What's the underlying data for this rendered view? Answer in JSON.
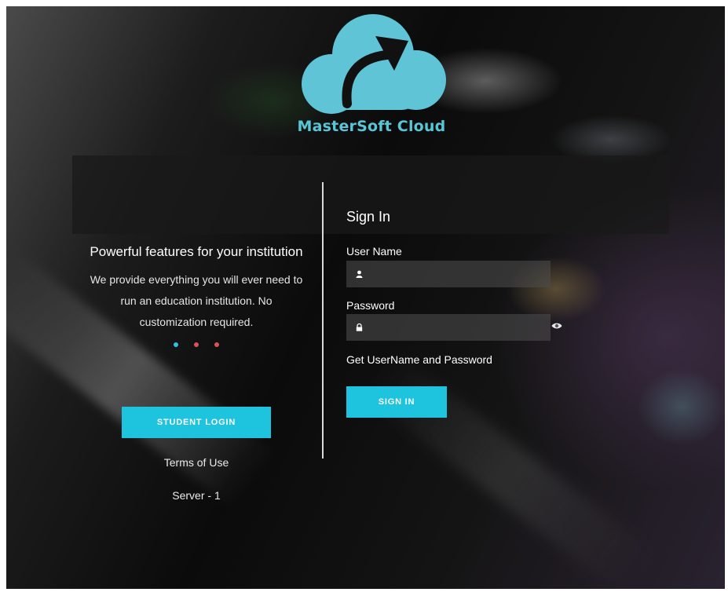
{
  "brand": {
    "name": "MasterSoft Cloud",
    "logo_icon": "cloud-arrow-icon",
    "color": "#57c6d6"
  },
  "left_panel": {
    "tagline": "Powerful features for your institution",
    "description": "We provide everything you will ever need to run an education institution. No customization required.",
    "carousel_dots": [
      "#2ec4dc",
      "#e0505c",
      "#e0505c"
    ],
    "student_login_label": "STUDENT LOGIN",
    "terms_label": "Terms of Use",
    "server_label": "Server - 1"
  },
  "sign_in": {
    "title": "Sign In",
    "username_label": "User Name",
    "username_icon": "user-icon",
    "username_value": "",
    "password_label": "Password",
    "password_icon": "lock-icon",
    "password_value": "",
    "show_password_icon": "eye-icon",
    "get_credentials_label": "Get UserName and Password",
    "submit_label": "SIGN IN"
  },
  "colors": {
    "accent": "#1ec3de",
    "field_bg": "#4b4b4b"
  }
}
